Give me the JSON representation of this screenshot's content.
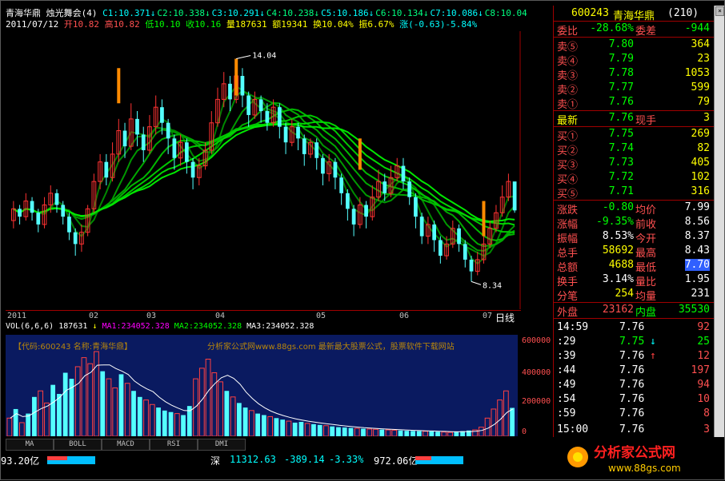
{
  "header": {
    "stock_name": "青海华鼎",
    "indicator": "烛光舞会(4)",
    "c_values": [
      "C1:10.371",
      "C2:10.338",
      "C3:10.291",
      "C4:10.238",
      "C5:10.186",
      "C6:10.134",
      "C7:10.086",
      "C8:10.04"
    ],
    "date": "2011/07/12",
    "open": "开10.82",
    "high": "高10.82",
    "low": "低10.10",
    "close": "收10.16",
    "volume": "量187631",
    "amount": "额19341",
    "turnover": "换10.04%",
    "amplitude": "振6.67%",
    "change": "涨(-0.63)-5.84%"
  },
  "kchart": {
    "high_label": "14.04",
    "low_label": "8.34",
    "x_labels": [
      "2011",
      "02",
      "03",
      "04",
      "05",
      "06",
      "07"
    ],
    "daily_label": "日线",
    "ylim": [
      8.0,
      14.5
    ],
    "candles": [
      [
        9.9,
        10.2,
        9.7,
        10.4
      ],
      [
        10.2,
        10.0,
        9.8,
        10.3
      ],
      [
        10.0,
        10.4,
        9.9,
        10.6
      ],
      [
        10.4,
        10.1,
        9.9,
        10.5
      ],
      [
        10.1,
        9.8,
        9.6,
        10.2
      ],
      [
        9.8,
        10.3,
        9.7,
        10.5
      ],
      [
        10.3,
        10.6,
        10.1,
        10.8
      ],
      [
        10.6,
        10.3,
        10.1,
        10.7
      ],
      [
        10.3,
        10.0,
        9.8,
        10.4
      ],
      [
        10.0,
        9.6,
        9.4,
        10.1
      ],
      [
        9.6,
        9.3,
        9.0,
        9.7
      ],
      [
        9.3,
        9.6,
        9.1,
        9.8
      ],
      [
        9.6,
        10.2,
        9.5,
        10.3
      ],
      [
        10.2,
        10.9,
        10.1,
        11.1
      ],
      [
        10.9,
        11.4,
        10.7,
        11.6
      ],
      [
        11.4,
        11.0,
        10.8,
        11.6
      ],
      [
        11.0,
        11.6,
        10.9,
        11.9
      ],
      [
        11.6,
        12.2,
        11.4,
        12.5
      ],
      [
        12.2,
        11.8,
        11.5,
        12.4
      ],
      [
        11.8,
        12.5,
        11.7,
        12.9
      ],
      [
        12.5,
        12.1,
        11.8,
        12.7
      ],
      [
        12.1,
        11.7,
        11.4,
        12.3
      ],
      [
        11.7,
        12.3,
        11.6,
        12.6
      ],
      [
        12.3,
        12.8,
        12.1,
        13.1
      ],
      [
        12.8,
        12.4,
        12.1,
        13.0
      ],
      [
        12.4,
        12.0,
        11.6,
        12.5
      ],
      [
        12.0,
        11.5,
        11.2,
        12.1
      ],
      [
        11.5,
        11.9,
        11.3,
        12.1
      ],
      [
        11.9,
        11.4,
        11.1,
        12.0
      ],
      [
        11.4,
        11.0,
        10.7,
        11.5
      ],
      [
        11.0,
        11.3,
        10.8,
        11.5
      ],
      [
        11.3,
        11.7,
        11.2,
        11.9
      ],
      [
        11.7,
        12.4,
        11.6,
        12.7
      ],
      [
        12.4,
        13.0,
        12.3,
        13.3
      ],
      [
        13.0,
        13.4,
        12.8,
        13.7
      ],
      [
        13.4,
        13.0,
        12.7,
        13.6
      ],
      [
        13.0,
        13.6,
        12.9,
        14.04
      ],
      [
        13.6,
        13.1,
        12.8,
        13.8
      ],
      [
        13.1,
        12.6,
        12.3,
        13.2
      ],
      [
        12.6,
        13.0,
        12.5,
        13.2
      ],
      [
        13.0,
        12.7,
        12.4,
        13.1
      ],
      [
        12.7,
        12.4,
        12.2,
        12.9
      ],
      [
        12.4,
        12.8,
        12.3,
        13.0
      ],
      [
        12.8,
        12.3,
        12.0,
        12.9
      ],
      [
        12.3,
        11.9,
        11.6,
        12.4
      ],
      [
        11.9,
        12.3,
        11.8,
        12.5
      ],
      [
        12.3,
        12.0,
        11.7,
        12.4
      ],
      [
        12.0,
        11.6,
        11.3,
        12.1
      ],
      [
        11.6,
        11.9,
        11.5,
        12.0
      ],
      [
        11.9,
        11.5,
        11.2,
        12.0
      ],
      [
        11.5,
        11.1,
        10.8,
        11.6
      ],
      [
        11.1,
        11.4,
        10.9,
        11.6
      ],
      [
        11.4,
        11.0,
        10.7,
        11.5
      ],
      [
        11.0,
        10.6,
        10.3,
        11.1
      ],
      [
        10.6,
        10.2,
        9.9,
        10.7
      ],
      [
        10.2,
        9.8,
        9.5,
        10.3
      ],
      [
        9.8,
        10.3,
        9.7,
        10.5
      ],
      [
        10.3,
        10.0,
        9.7,
        10.4
      ],
      [
        10.0,
        10.5,
        9.9,
        10.8
      ],
      [
        10.5,
        10.9,
        10.4,
        11.2
      ],
      [
        10.9,
        10.6,
        10.4,
        11.1
      ],
      [
        10.6,
        11.0,
        10.5,
        11.3
      ],
      [
        11.0,
        11.3,
        10.9,
        11.5
      ],
      [
        11.3,
        10.9,
        10.7,
        11.5
      ],
      [
        10.9,
        10.5,
        10.3,
        11.0
      ],
      [
        10.5,
        10.0,
        9.7,
        10.6
      ],
      [
        10.0,
        9.5,
        9.3,
        10.1
      ],
      [
        9.5,
        9.8,
        9.3,
        10.0
      ],
      [
        9.8,
        9.4,
        9.1,
        9.9
      ],
      [
        9.4,
        9.0,
        8.8,
        9.5
      ],
      [
        9.0,
        9.3,
        8.9,
        9.5
      ],
      [
        9.3,
        9.7,
        9.2,
        9.9
      ],
      [
        9.7,
        9.3,
        9.1,
        9.8
      ],
      [
        9.3,
        8.9,
        8.7,
        9.4
      ],
      [
        8.9,
        8.6,
        8.34,
        9.0
      ],
      [
        8.6,
        8.9,
        8.5,
        9.1
      ],
      [
        8.9,
        9.3,
        8.8,
        9.5
      ],
      [
        9.3,
        9.7,
        9.2,
        9.9
      ],
      [
        9.7,
        10.1,
        9.6,
        10.3
      ],
      [
        10.1,
        10.5,
        10.0,
        10.8
      ],
      [
        10.5,
        10.9,
        10.4,
        11.1
      ],
      [
        10.9,
        10.16,
        10.1,
        10.82
      ]
    ],
    "highlights": [
      [
        17,
        12.9,
        13.8
      ],
      [
        36,
        13.1,
        14.04
      ],
      [
        56,
        11.2,
        12.0
      ],
      [
        76,
        9.5,
        10.4
      ]
    ]
  },
  "volume": {
    "label": "VOL(6,6,6)",
    "vol_value": "187631",
    "ma1": "MA1:234052.328",
    "ma2": "MA2:234052.328",
    "ma3": "MA3:234052.328",
    "watermark_left": "【代码:600243 名称:青海华鼎】",
    "watermark_right": "分析家公式网www.88gs.com 最新最大股票公式，股票软件下载网站",
    "scale": [
      "600000",
      "400000",
      "200000",
      "0"
    ],
    "ylim": [
      0,
      650000
    ],
    "bars": [
      120000,
      180000,
      90000,
      150000,
      260000,
      300000,
      220000,
      340000,
      280000,
      420000,
      380000,
      460000,
      520000,
      480000,
      560000,
      430000,
      380000,
      320000,
      410000,
      350000,
      300000,
      260000,
      240000,
      210000,
      190000,
      170000,
      160000,
      150000,
      140000,
      200000,
      380000,
      450000,
      510000,
      420000,
      360000,
      300000,
      260000,
      220000,
      190000,
      170000,
      150000,
      140000,
      130000,
      120000,
      110000,
      100000,
      90000,
      95000,
      85000,
      80000,
      75000,
      70000,
      65000,
      60000,
      58000,
      55000,
      52000,
      50000,
      48000,
      46000,
      44000,
      42000,
      40000,
      38000,
      36000,
      35000,
      34000,
      33000,
      32000,
      30000,
      28000,
      26000,
      30000,
      34000,
      38000,
      42000,
      60000,
      120000,
      180000,
      240000,
      300000,
      187631
    ]
  },
  "tabs": [
    "MA",
    "BOLL",
    "MACD",
    "RSI",
    "DMI"
  ],
  "status": {
    "left_value": "93.20亿",
    "market": "深",
    "index": "11312.63",
    "change": "-389.14",
    "pct": "-3.33%",
    "amount": "972.06亿"
  },
  "quote": {
    "code": "600243",
    "name": "青海华鼎",
    "period": "(210)",
    "weibi_label": "委比",
    "weibi": "-28.68%",
    "weicha_label": "委差",
    "weicha": "-944",
    "asks": [
      {
        "label": "卖⑤",
        "price": "7.80",
        "vol": "364"
      },
      {
        "label": "卖④",
        "price": "7.79",
        "vol": "23"
      },
      {
        "label": "卖③",
        "price": "7.78",
        "vol": "1053"
      },
      {
        "label": "卖②",
        "price": "7.77",
        "vol": "599"
      },
      {
        "label": "卖①",
        "price": "7.76",
        "vol": "79"
      }
    ],
    "latest_label": "最新",
    "latest": "7.76",
    "xianshou_label": "现手",
    "xianshou": "3",
    "bids": [
      {
        "label": "买①",
        "price": "7.75",
        "vol": "269"
      },
      {
        "label": "买②",
        "price": "7.74",
        "vol": "82"
      },
      {
        "label": "买③",
        "price": "7.73",
        "vol": "405"
      },
      {
        "label": "买④",
        "price": "7.72",
        "vol": "102"
      },
      {
        "label": "买⑤",
        "price": "7.71",
        "vol": "316"
      }
    ],
    "stats": [
      {
        "l1": "涨跌",
        "v1": "-0.80",
        "l2": "均价",
        "v2": "7.99"
      },
      {
        "l1": "涨幅",
        "v1": "-9.35%",
        "l2": "前收",
        "v2": "8.56"
      },
      {
        "l1": "振幅",
        "v1": "8.53%",
        "l2": "今开",
        "v2": "8.37"
      },
      {
        "l1": "总手",
        "v1": "58692",
        "l2": "最高",
        "v2": "8.43"
      },
      {
        "l1": "总额",
        "v1": "4688",
        "l2": "最低",
        "v2": "7.70"
      },
      {
        "l1": "换手",
        "v1": "3.14%",
        "l2": "量比",
        "v2": "1.95"
      },
      {
        "l1": "分笔",
        "v1": "254",
        "l2": "均量",
        "v2": "231"
      }
    ],
    "waipan_label": "外盘",
    "waipan": "23162",
    "neipan_label": "内盘",
    "neipan": "35530",
    "ticks": [
      {
        "time": "14:59",
        "price": "7.76",
        "arrow": "",
        "vol": "92"
      },
      {
        "time": ":29",
        "price": "7.75",
        "arrow": "↓",
        "vol": "25"
      },
      {
        "time": ":39",
        "price": "7.76",
        "arrow": "↑",
        "vol": "12"
      },
      {
        "time": ":44",
        "price": "7.76",
        "arrow": "",
        "vol": "197"
      },
      {
        "time": ":49",
        "price": "7.76",
        "arrow": "",
        "vol": "94"
      },
      {
        "time": ":54",
        "price": "7.76",
        "arrow": "",
        "vol": "10"
      },
      {
        "time": ":59",
        "price": "7.76",
        "arrow": "",
        "vol": "8"
      },
      {
        "time": "15:00",
        "price": "7.76",
        "arrow": "",
        "vol": "3"
      }
    ]
  },
  "logo": {
    "text": "分析家公式网",
    "url": "www.88gs.com"
  }
}
